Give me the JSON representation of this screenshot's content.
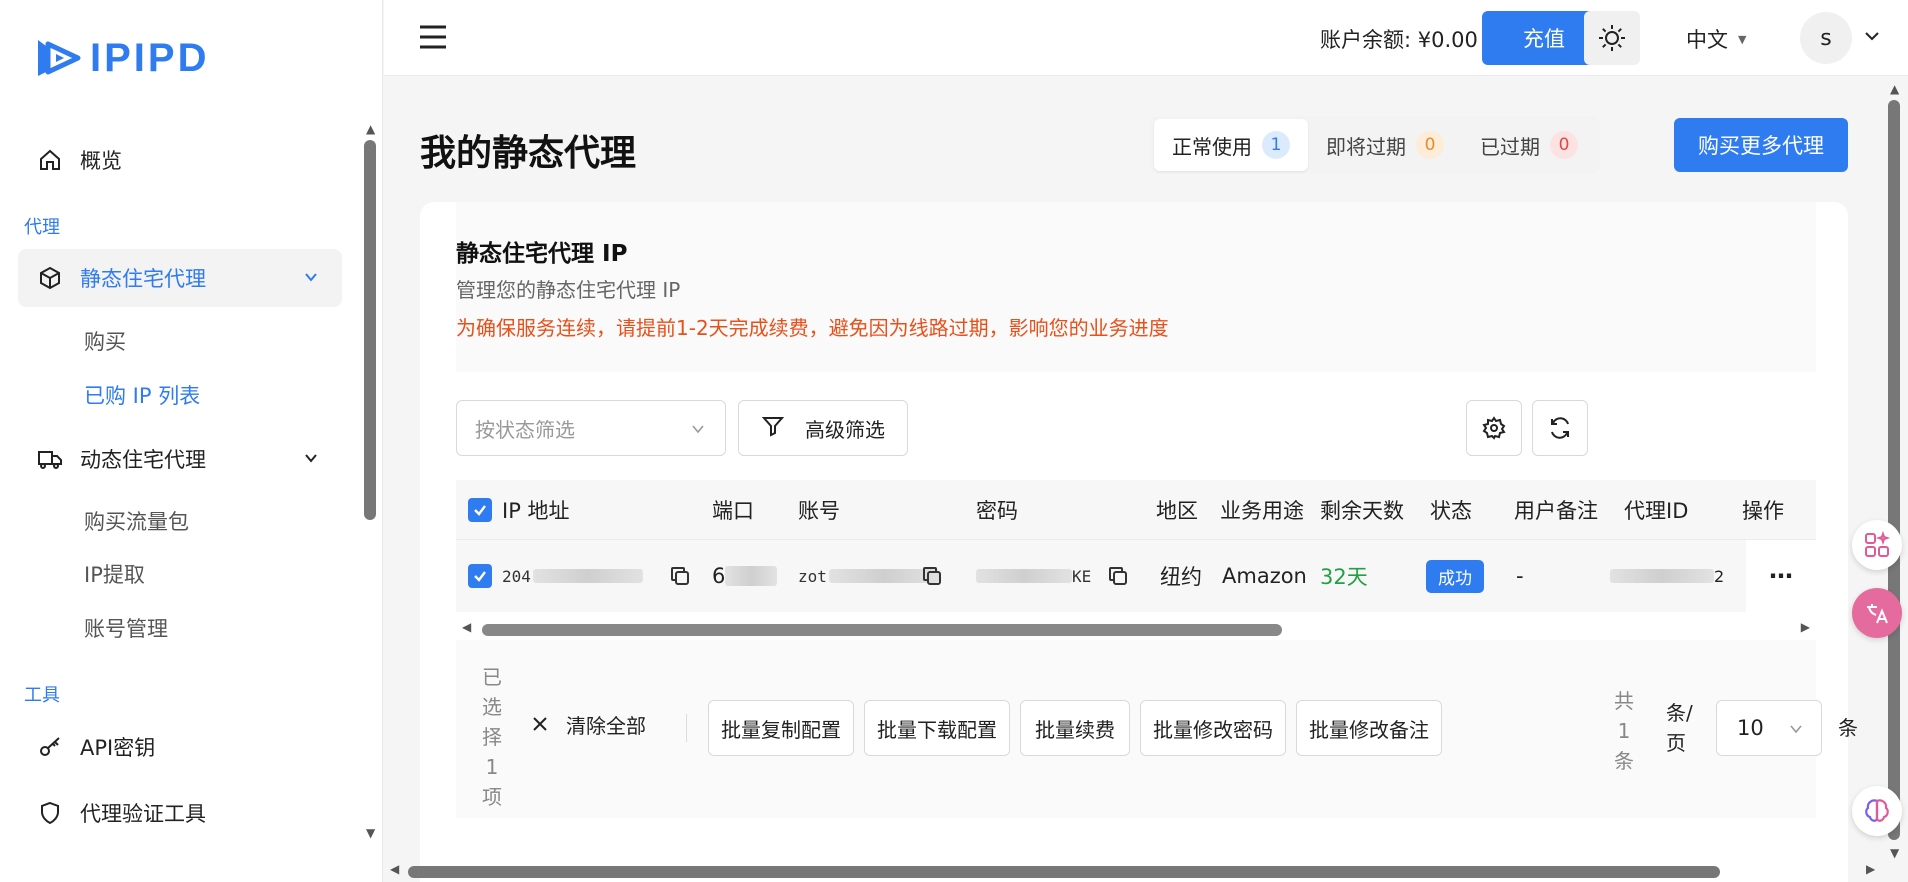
{
  "brand": {
    "name": "IPIPD"
  },
  "sidebar": {
    "items": [
      {
        "label": "概览",
        "icon": "home-icon"
      },
      {
        "section": "代理"
      },
      {
        "label": "静态住宅代理",
        "icon": "box-icon",
        "active": true
      },
      {
        "label": "购买"
      },
      {
        "label": "已购 IP 列表",
        "active": true
      },
      {
        "label": "动态住宅代理",
        "icon": "truck-icon"
      },
      {
        "label": "购买流量包"
      },
      {
        "label": "IP提取"
      },
      {
        "label": "账号管理"
      },
      {
        "section": "工具"
      },
      {
        "label": "API密钥",
        "icon": "key-icon"
      },
      {
        "label": "代理验证工具",
        "icon": "shield-icon"
      }
    ]
  },
  "topbar": {
    "balance": "账户余额: ¥0.00",
    "recharge": "充值",
    "language": "中文",
    "avatar_letter": "s"
  },
  "main": {
    "title": "我的静态代理",
    "tabs": [
      {
        "label": "正常使用",
        "count": "1"
      },
      {
        "label": "即将过期",
        "count": "0"
      },
      {
        "label": "已过期",
        "count": "0"
      }
    ],
    "buy_more": "购买更多代理",
    "card": {
      "title": "静态住宅代理 IP",
      "subtitle": "管理您的静态住宅代理 IP",
      "warning": "为确保服务连续，请提前1-2天完成续费，避免因为线路过期，影响您的业务进度"
    },
    "filter_placeholder": "按状态筛选",
    "advanced_filter": "高级筛选",
    "table": {
      "headers": [
        "IP 地址",
        "端口",
        "账号",
        "密码",
        "地区",
        "业务用途",
        "剩余天数",
        "状态",
        "用户备注",
        "代理ID",
        "操作"
      ],
      "rows": [
        {
          "ip": "204",
          "port": "6",
          "account": "zot",
          "password": "KE",
          "region": "纽约",
          "usage": "Amazon",
          "days": "32天",
          "status": "成功",
          "note": "-",
          "proxy_id": "2"
        }
      ]
    },
    "bulk": {
      "selected": [
        "已",
        "选",
        "择",
        "1",
        "项"
      ],
      "clear_all": "清除全部",
      "buttons": [
        "批量复制配置",
        "批量下载配置",
        "批量续费",
        "批量修改密码",
        "批量修改备注"
      ],
      "total": [
        "共",
        "1",
        "条"
      ],
      "per_page": [
        "条/",
        "页"
      ],
      "page_size": "10",
      "tiao": "条"
    }
  },
  "colors": {
    "accent": "#2f7bf0",
    "warning": "#e8501a",
    "success": "#22a045"
  }
}
